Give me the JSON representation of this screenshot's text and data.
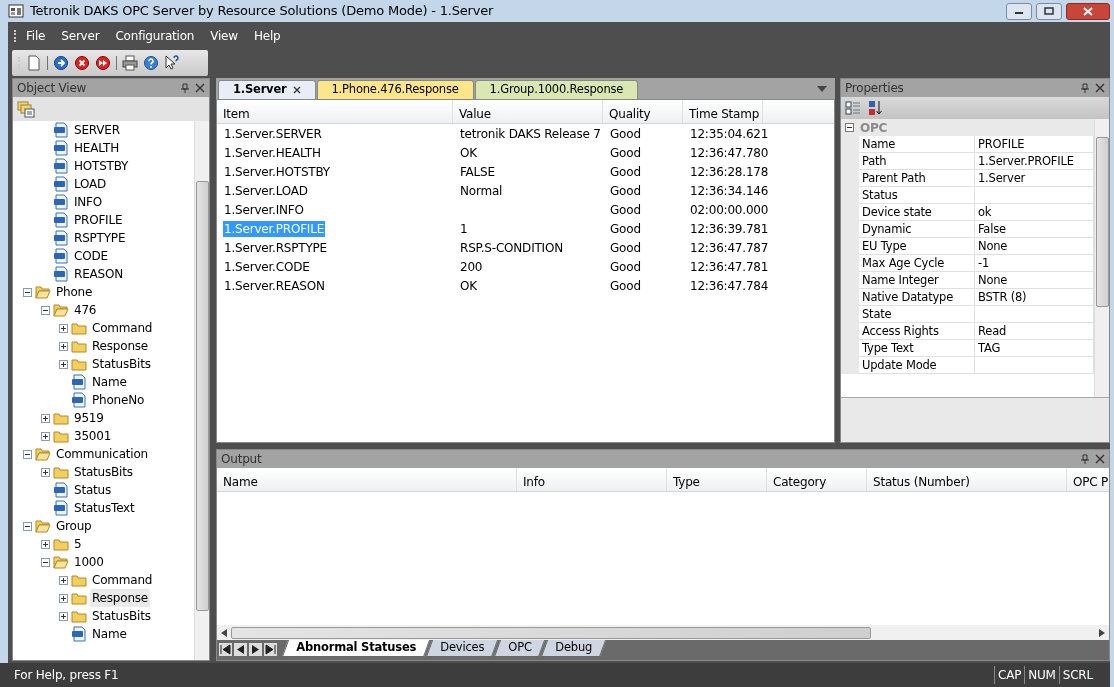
{
  "window": {
    "title": "Tetronik DAKS OPC Server by Resource Solutions (Demo Mode) - 1.Server"
  },
  "menu": [
    "File",
    "Server",
    "Configuration",
    "View",
    "Help"
  ],
  "object_view": {
    "title": "Object View",
    "tree": [
      {
        "children": [
          {
            "children": [
              {
                "label": "SERVER",
                "kind": "tag",
                "selected": false
              },
              {
                "label": "HEALTH",
                "kind": "tag",
                "selected": false
              },
              {
                "label": "HOTSTBY",
                "kind": "tag",
                "selected": false
              },
              {
                "label": "LOAD",
                "kind": "tag",
                "selected": false
              },
              {
                "label": "INFO",
                "kind": "tag",
                "selected": false
              },
              {
                "label": "PROFILE",
                "kind": "tag",
                "selected": false
              },
              {
                "label": "RSPTYPE",
                "kind": "tag",
                "selected": false
              },
              {
                "label": "CODE",
                "kind": "tag",
                "selected": false
              },
              {
                "label": "REASON",
                "kind": "tag",
                "selected": false
              }
            ]
          },
          {
            "label": "Phone",
            "kind": "folder",
            "expanded": true,
            "selected": false,
            "children": [
              {
                "label": "476",
                "kind": "folder",
                "expanded": true,
                "selected": false,
                "children": [
                  {
                    "label": "Command",
                    "kind": "folder",
                    "expanded": false,
                    "selected": false
                  },
                  {
                    "label": "Response",
                    "kind": "folder",
                    "expanded": false,
                    "selected": false
                  },
                  {
                    "label": "StatusBits",
                    "kind": "folder",
                    "expanded": false,
                    "selected": false
                  },
                  {
                    "label": "Name",
                    "kind": "tag",
                    "selected": false
                  },
                  {
                    "label": "PhoneNo",
                    "kind": "tag",
                    "selected": false
                  }
                ]
              },
              {
                "label": "9519",
                "kind": "folder",
                "expanded": false,
                "selected": false
              },
              {
                "label": "35001",
                "kind": "folder",
                "expanded": false,
                "selected": false
              }
            ]
          },
          {
            "label": "Communication",
            "kind": "folder",
            "expanded": true,
            "selected": false,
            "children": [
              {
                "label": "StatusBits",
                "kind": "folder",
                "expanded": false,
                "selected": false
              },
              {
                "label": "Status",
                "kind": "tag",
                "selected": false
              },
              {
                "label": "StatusText",
                "kind": "tag",
                "selected": false
              }
            ]
          },
          {
            "label": "Group",
            "kind": "folder",
            "expanded": true,
            "selected": false,
            "children": [
              {
                "label": "5",
                "kind": "folder",
                "expanded": false,
                "selected": false
              },
              {
                "label": "1000",
                "kind": "folder",
                "expanded": true,
                "selected": false,
                "children": [
                  {
                    "label": "Command",
                    "kind": "folder",
                    "expanded": false,
                    "selected": false
                  },
                  {
                    "label": "Response",
                    "kind": "folder",
                    "expanded": false,
                    "selected": true
                  },
                  {
                    "label": "StatusBits",
                    "kind": "folder",
                    "expanded": false,
                    "selected": false
                  },
                  {
                    "label": "Name",
                    "kind": "tag",
                    "selected": false
                  }
                ]
              }
            ]
          }
        ]
      }
    ]
  },
  "documents": {
    "tabs": [
      {
        "label": "1.Server",
        "selected": true,
        "color": "#e8eef8"
      },
      {
        "label": "1.Phone.476.Response",
        "selected": false,
        "color": "#fde58a"
      },
      {
        "label": "1.Group.1000.Response",
        "selected": false,
        "color": "#d9e8b0"
      }
    ],
    "table": {
      "columns": [
        "Item",
        "Value",
        "Quality",
        "Time Stamp"
      ],
      "rows": [
        {
          "cells": [
            "1.Server.SERVER",
            "tetronik DAKS Release 7",
            "Good",
            "12:35:04.621"
          ],
          "selected": false
        },
        {
          "cells": [
            "1.Server.HEALTH",
            "OK",
            "Good",
            "12:36:47.780"
          ],
          "selected": false
        },
        {
          "cells": [
            "1.Server.HOTSTBY",
            "FALSE",
            "Good",
            "12:36:28.178"
          ],
          "selected": false
        },
        {
          "cells": [
            "1.Server.LOAD",
            "Normal",
            "Good",
            "12:36:34.146"
          ],
          "selected": false
        },
        {
          "cells": [
            "1.Server.INFO",
            "",
            "Good",
            "02:00:00.000"
          ],
          "selected": false
        },
        {
          "cells": [
            "1.Server.PROFILE",
            "1",
            "Good",
            "12:36:39.781"
          ],
          "selected": true
        },
        {
          "cells": [
            "1.Server.RSPTYPE",
            "RSP.S-CONDITION",
            "Good",
            "12:36:47.787"
          ],
          "selected": false
        },
        {
          "cells": [
            "1.Server.CODE",
            "200",
            "Good",
            "12:36:47.781"
          ],
          "selected": false
        },
        {
          "cells": [
            "1.Server.REASON",
            "OK",
            "Good",
            "12:36:47.784"
          ],
          "selected": false
        }
      ]
    }
  },
  "properties": {
    "title": "Properties",
    "categories": [
      {
        "name": "OPC",
        "expanded": true,
        "rows": [
          {
            "name": "Name",
            "value": "PROFILE"
          },
          {
            "name": "Path",
            "value": "1.Server.PROFILE"
          },
          {
            "name": "Parent Path",
            "value": "1.Server"
          },
          {
            "name": "Status",
            "value": ""
          },
          {
            "name": "Device state",
            "value": "ok"
          },
          {
            "name": "Dynamic",
            "value": "False"
          },
          {
            "name": "EU Type",
            "value": "None"
          },
          {
            "name": "Max Age Cycle",
            "value": "-1"
          },
          {
            "name": "Name Integer",
            "value": "None"
          },
          {
            "name": "Native Datatype",
            "value": "BSTR (8)"
          },
          {
            "name": "State",
            "value": ""
          },
          {
            "name": "Access Rights",
            "value": "Read"
          },
          {
            "name": "Type Text",
            "value": "TAG"
          },
          {
            "name": "Update Mode",
            "value": ""
          }
        ]
      }
    ]
  },
  "output": {
    "title": "Output",
    "columns": [
      "Name",
      "Info",
      "Type",
      "Category",
      "Status (Number)",
      "OPC P"
    ],
    "tabs": [
      {
        "label": "Abnormal Statuses",
        "selected": true
      },
      {
        "label": "Devices",
        "selected": false
      },
      {
        "label": "OPC",
        "selected": false
      },
      {
        "label": "Debug",
        "selected": false
      }
    ]
  },
  "status_bar": {
    "text": "For Help, press F1",
    "indicators": [
      "CAP",
      "NUM",
      "SCRL"
    ]
  }
}
